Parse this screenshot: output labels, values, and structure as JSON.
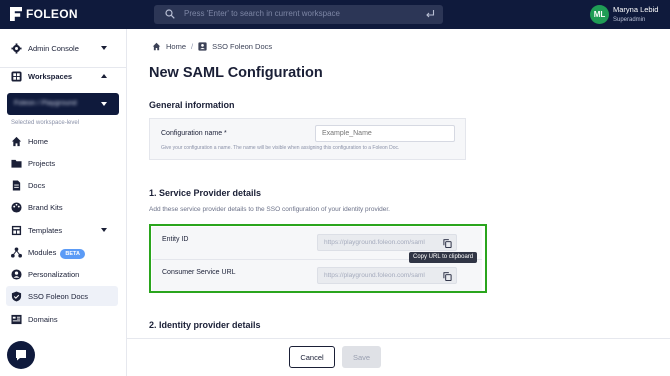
{
  "app": {
    "logo_text": "FOLEON"
  },
  "search": {
    "placeholder": "Press 'Enter' to search in current workspace"
  },
  "user": {
    "initials": "ML",
    "name": "Maryna Lebid",
    "role": "Superadmin"
  },
  "sidebar": {
    "admin_console": "Admin Console",
    "workspaces": "Workspaces",
    "workspace_selected": "Foleon / Playground",
    "workspace_level_label": "Selected workspace-level",
    "items": [
      {
        "label": "Home",
        "icon": "home-icon"
      },
      {
        "label": "Projects",
        "icon": "folder-icon"
      },
      {
        "label": "Docs",
        "icon": "doc-icon"
      },
      {
        "label": "Brand Kits",
        "icon": "palette-icon"
      },
      {
        "label": "Templates",
        "icon": "template-icon"
      },
      {
        "label": "Modules",
        "icon": "modules-icon",
        "badge": "BETA"
      },
      {
        "label": "Personalization",
        "icon": "person-icon"
      },
      {
        "label": "SSO Foleon Docs",
        "icon": "shield-icon",
        "active": true
      },
      {
        "label": "Domains",
        "icon": "domains-icon"
      }
    ]
  },
  "breadcrumb": {
    "home": "Home",
    "sep": "/",
    "current": "SSO Foleon Docs"
  },
  "page": {
    "title": "New SAML Configuration"
  },
  "general": {
    "title": "General information",
    "config_label": "Configuration name *",
    "config_placeholder": "Example_Name",
    "config_help": "Give your configuration a name. The name will be visible when assigning this configuration to a Foleon Doc."
  },
  "service_provider": {
    "title": "1. Service Provider details",
    "description": "Add these service provider details to the SSO configuration of your identity provider.",
    "entity_id_label": "Entity ID",
    "entity_id_value": "https://playground.foleon.com/saml",
    "acs_label": "Consumer Service URL",
    "acs_value": "https://playground.foleon.com/saml",
    "copy_tooltip": "Copy URL to clipboard"
  },
  "identity_provider": {
    "title": "2. Identity provider details"
  },
  "footer": {
    "cancel": "Cancel",
    "save": "Save"
  },
  "colors": {
    "nav": "#0f1a3c",
    "highlight_border": "#2aa51d",
    "avatar": "#1f9d55",
    "beta": "#5b9bf6"
  }
}
